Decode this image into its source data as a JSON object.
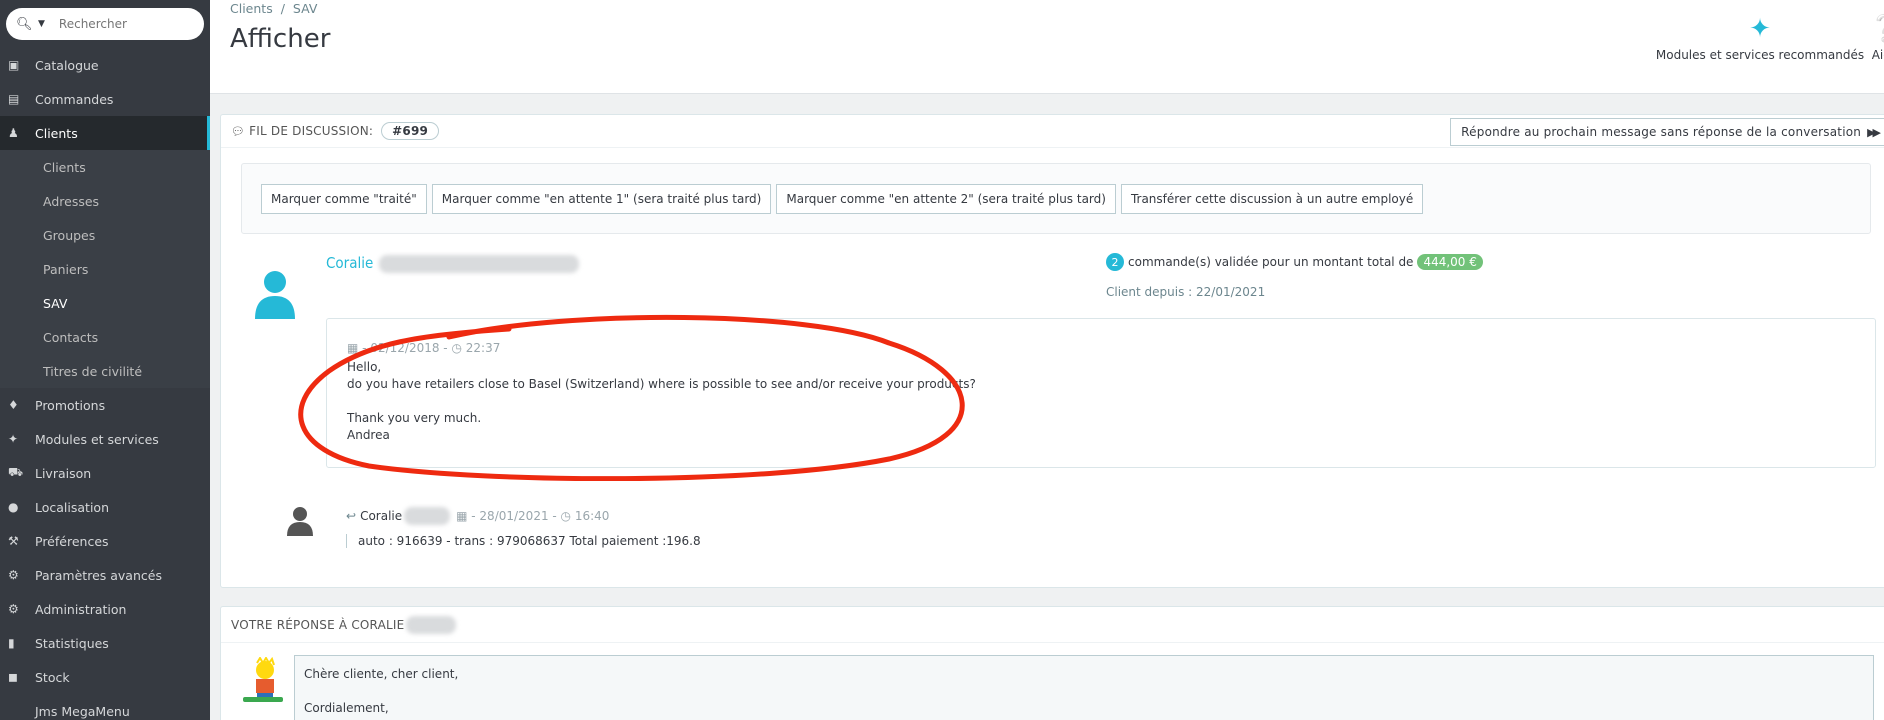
{
  "search": {
    "placeholder": "Rechercher"
  },
  "sidebar": {
    "items": [
      {
        "label": "Catalogue",
        "icon": "catalog-icon"
      },
      {
        "label": "Commandes",
        "icon": "orders-icon"
      },
      {
        "label": "Clients",
        "icon": "customers-icon"
      },
      {
        "label": "Clients",
        "icon": ""
      },
      {
        "label": "Adresses",
        "icon": ""
      },
      {
        "label": "Groupes",
        "icon": ""
      },
      {
        "label": "Paniers",
        "icon": ""
      },
      {
        "label": "SAV",
        "icon": ""
      },
      {
        "label": "Contacts",
        "icon": ""
      },
      {
        "label": "Titres de civilité",
        "icon": ""
      },
      {
        "label": "Promotions",
        "icon": "tag-icon"
      },
      {
        "label": "Modules et services",
        "icon": "puzzle-icon"
      },
      {
        "label": "Livraison",
        "icon": "truck-icon"
      },
      {
        "label": "Localisation",
        "icon": "globe-icon"
      },
      {
        "label": "Préférences",
        "icon": "wrench-icon"
      },
      {
        "label": "Paramètres avancés",
        "icon": "cogs-icon"
      },
      {
        "label": "Administration",
        "icon": "gear-icon"
      },
      {
        "label": "Statistiques",
        "icon": "stats-icon"
      },
      {
        "label": "Stock",
        "icon": "stock-icon"
      },
      {
        "label": "Jms MegaMenu",
        "icon": ""
      }
    ]
  },
  "header": {
    "breadcrumb": [
      "Clients",
      "SAV"
    ],
    "breadcrumb_sep": "/",
    "title": "Afficher",
    "modules_label": "Modules et services recommandés",
    "help_label": "Aide"
  },
  "thread": {
    "heading": "FIL DE DISCUSSION:",
    "id": "#699",
    "next_label": "Répondre au prochain message sans réponse de la conversation",
    "actions": [
      "Marquer comme \"traité\"",
      "Marquer comme \"en attente 1\" (sera traité plus tard)",
      "Marquer comme \"en attente 2\" (sera traité plus tard)",
      "Transférer cette discussion à un autre employé"
    ],
    "customer_name": "Coralie",
    "orders_count": "2",
    "orders_text": "commande(s) validée pour un montant total de",
    "orders_total": "444,00 €",
    "client_since": "Client depuis : 22/01/2021",
    "message": {
      "date": "- 02/12/2018 -",
      "time": "22:37",
      "body": "Hello,\ndo you have retailers close to Basel (Switzerland) where is possible to see and/or receive your products?\n\nThank you very much.\nAndrea"
    },
    "reply": {
      "author": "Coralie",
      "date": "- 28/01/2021 -",
      "time": "16:40",
      "body": "auto : 916639 - trans : 979068637 Total paiement :196.8"
    },
    "annotation_color": "#ee2a10"
  },
  "reply_panel": {
    "heading": "VOTRE RÉPONSE À CORALIE",
    "text": "Chère cliente, cher client,\n\nCordialement,"
  },
  "colors": {
    "accent": "#25b9d7",
    "success": "#72c279",
    "sidebar": "#363a41"
  }
}
